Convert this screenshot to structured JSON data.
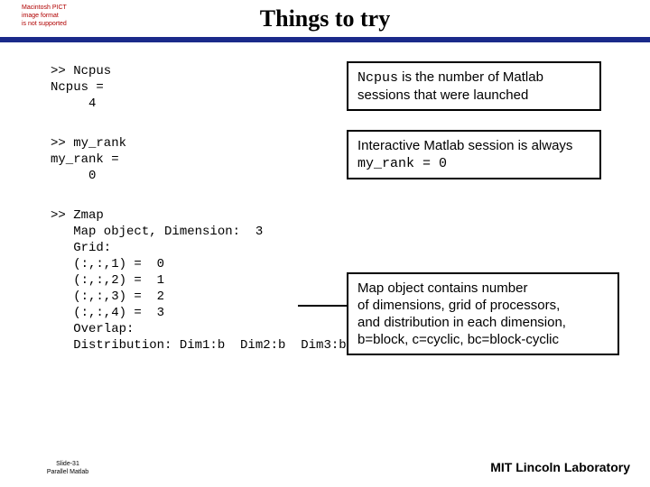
{
  "title": "Things to try",
  "pict_warning": "Macintosh PICT\nimage format\nis not supported",
  "code": {
    "ncpus": ">> Ncpus\nNcpus =\n     4",
    "myrank": ">> my_rank\nmy_rank =\n     0",
    "zmap": ">> Zmap\n   Map object, Dimension:  3\n   Grid:\n   (:,:,1) =  0\n   (:,:,2) =  1\n   (:,:,3) =  2\n   (:,:,4) =  3\n   Overlap:\n   Distribution: Dim1:b  Dim2:b  Dim3:b"
  },
  "callouts": {
    "c1_pre": "Ncpus",
    "c1_post": " is the number of Matlab sessions that were launched",
    "c2_pre": "Interactive Matlab session is always ",
    "c2_mono": "my_rank = 0",
    "c3": "Map object contains number\nof dimensions, grid of processors,\nand distribution in each dimension,\nb=block, c=cyclic, bc=block-cyclic"
  },
  "footer": {
    "slide": "Slide-31",
    "subject": "Parallel Matlab"
  },
  "lab": "MIT Lincoln Laboratory"
}
